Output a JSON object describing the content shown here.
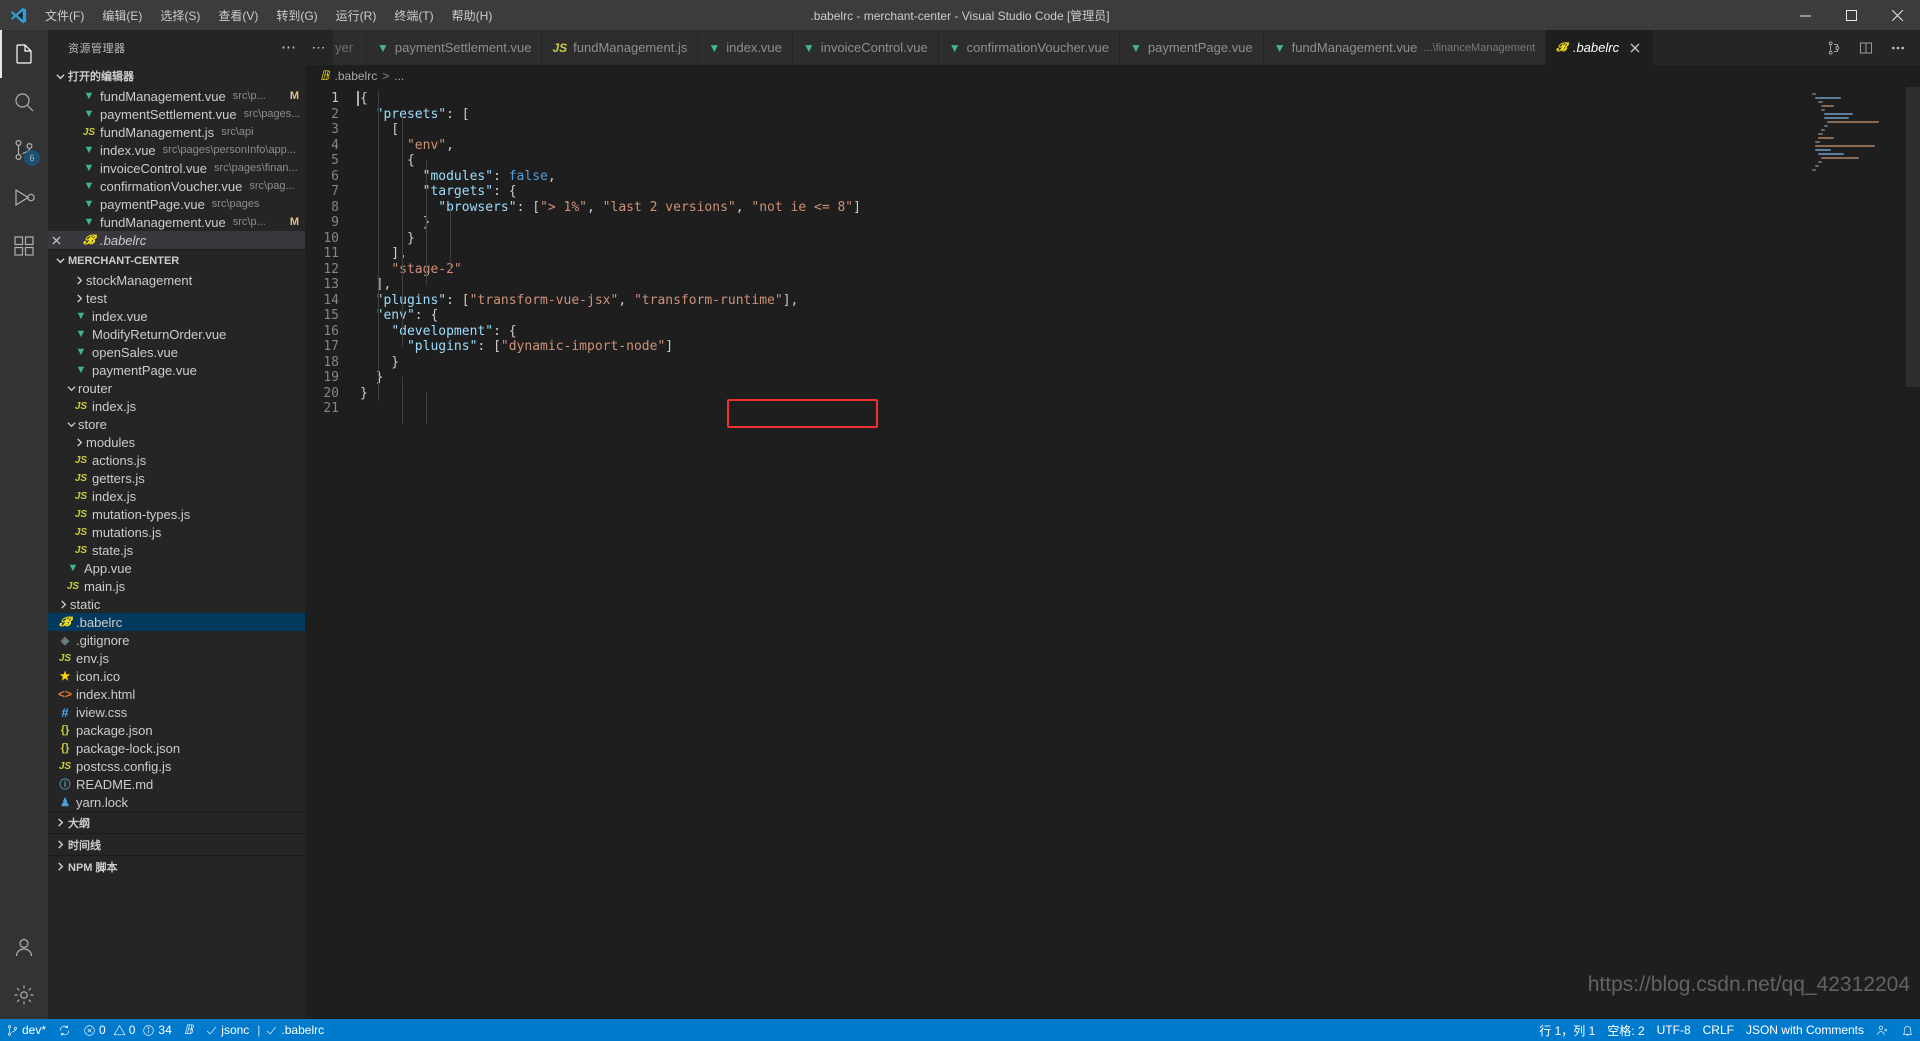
{
  "window": {
    "title": ".babelrc - merchant-center - Visual Studio Code [管理员]",
    "logo_name": "vscode-logo"
  },
  "menubar": [
    {
      "label": "文件(F)"
    },
    {
      "label": "编辑(E)"
    },
    {
      "label": "选择(S)"
    },
    {
      "label": "查看(V)"
    },
    {
      "label": "转到(G)"
    },
    {
      "label": "运行(R)"
    },
    {
      "label": "终端(T)"
    },
    {
      "label": "帮助(H)"
    }
  ],
  "window_controls": {
    "minimize": "minimize-button",
    "maximize": "maximize-button",
    "close": "close-button"
  },
  "activitybar": [
    {
      "name": "explorer",
      "icon": "files-icon",
      "active": true,
      "badge": ""
    },
    {
      "name": "search",
      "icon": "search-icon",
      "active": false,
      "badge": ""
    },
    {
      "name": "source-control",
      "icon": "source-control-icon",
      "active": false,
      "badge": "6"
    },
    {
      "name": "run-and-debug",
      "icon": "run-debug-icon",
      "active": false,
      "badge": ""
    },
    {
      "name": "extensions",
      "icon": "extensions-icon",
      "active": false,
      "badge": ""
    },
    {
      "name": "accounts",
      "icon": "account-icon",
      "active": false,
      "badge": ""
    },
    {
      "name": "manage",
      "icon": "gear-icon",
      "active": false,
      "badge": ""
    }
  ],
  "sidebar": {
    "title": "资源管理器",
    "open_editors": {
      "label": "打开的编辑器",
      "expanded": true,
      "items": [
        {
          "icon": "vue",
          "name": "fundManagement.vue",
          "desc": "src\\p...",
          "badge": "M",
          "active": false
        },
        {
          "icon": "vue",
          "name": "paymentSettlement.vue",
          "desc": "src\\pages...",
          "badge": "",
          "active": false
        },
        {
          "icon": "js",
          "name": "fundManagement.js",
          "desc": "src\\api",
          "badge": "",
          "active": false
        },
        {
          "icon": "vue",
          "name": "index.vue",
          "desc": "src\\pages\\personInfo\\app...",
          "badge": "",
          "active": false
        },
        {
          "icon": "vue",
          "name": "invoiceControl.vue",
          "desc": "src\\pages\\finan...",
          "badge": "",
          "active": false
        },
        {
          "icon": "vue",
          "name": "confirmationVoucher.vue",
          "desc": "src\\pag...",
          "badge": "",
          "active": false
        },
        {
          "icon": "vue",
          "name": "paymentPage.vue",
          "desc": "src\\pages",
          "badge": "",
          "active": false
        },
        {
          "icon": "vue",
          "name": "fundManagement.vue",
          "desc": "src\\p...",
          "badge": "M",
          "active": false
        },
        {
          "icon": "babel",
          "name": ".babelrc",
          "desc": "",
          "badge": "",
          "active": true,
          "italic": true,
          "closable": true
        }
      ]
    },
    "project": {
      "label": "MERCHANT-CENTER",
      "expanded": true,
      "items": [
        {
          "type": "folder",
          "name": "stockManagement",
          "depth": 2,
          "expanded": false
        },
        {
          "type": "folder",
          "name": "test",
          "depth": 2,
          "expanded": false
        },
        {
          "type": "vue",
          "name": "index.vue",
          "depth": 2
        },
        {
          "type": "vue",
          "name": "ModifyReturnOrder.vue",
          "depth": 2
        },
        {
          "type": "vue",
          "name": "openSales.vue",
          "depth": 2
        },
        {
          "type": "vue",
          "name": "paymentPage.vue",
          "depth": 2
        },
        {
          "type": "folder",
          "name": "router",
          "depth": 1,
          "expanded": true
        },
        {
          "type": "js",
          "name": "index.js",
          "depth": 2
        },
        {
          "type": "folder",
          "name": "store",
          "depth": 1,
          "expanded": true
        },
        {
          "type": "folder",
          "name": "modules",
          "depth": 2,
          "expanded": false
        },
        {
          "type": "js",
          "name": "actions.js",
          "depth": 2
        },
        {
          "type": "js",
          "name": "getters.js",
          "depth": 2
        },
        {
          "type": "js",
          "name": "index.js",
          "depth": 2
        },
        {
          "type": "js",
          "name": "mutation-types.js",
          "depth": 2
        },
        {
          "type": "js",
          "name": "mutations.js",
          "depth": 2
        },
        {
          "type": "js",
          "name": "state.js",
          "depth": 2
        },
        {
          "type": "vue",
          "name": "App.vue",
          "depth": 1
        },
        {
          "type": "js",
          "name": "main.js",
          "depth": 1
        },
        {
          "type": "folder",
          "name": "static",
          "depth": 0,
          "expanded": false
        },
        {
          "type": "babel",
          "name": ".babelrc",
          "depth": 0,
          "selected": true
        },
        {
          "type": "git",
          "name": ".gitignore",
          "depth": 0
        },
        {
          "type": "js",
          "name": "env.js",
          "depth": 0
        },
        {
          "type": "star",
          "name": "icon.ico",
          "depth": 0
        },
        {
          "type": "html",
          "name": "index.html",
          "depth": 0
        },
        {
          "type": "css",
          "name": "iview.css",
          "depth": 0
        },
        {
          "type": "json",
          "name": "package.json",
          "depth": 0
        },
        {
          "type": "json",
          "name": "package-lock.json",
          "depth": 0
        },
        {
          "type": "js",
          "name": "postcss.config.js",
          "depth": 0
        },
        {
          "type": "md",
          "name": "README.md",
          "depth": 0
        },
        {
          "type": "lock",
          "name": "yarn.lock",
          "depth": 0
        }
      ]
    },
    "bottom_sections": [
      {
        "label": "大纲",
        "expanded": false
      },
      {
        "label": "时间线",
        "expanded": false
      },
      {
        "label": "NPM 脚本",
        "expanded": false
      }
    ]
  },
  "tabs": {
    "scrolled_fragment": "yer",
    "more_icon": "more-tabs-icon",
    "items": [
      {
        "icon": "vue",
        "label": "paymentSettlement.vue",
        "desc": "",
        "active": false
      },
      {
        "icon": "js",
        "label": "fundManagement.js",
        "desc": "",
        "active": false
      },
      {
        "icon": "vue",
        "label": "index.vue",
        "desc": "",
        "active": false
      },
      {
        "icon": "vue",
        "label": "invoiceControl.vue",
        "desc": "",
        "active": false
      },
      {
        "icon": "vue",
        "label": "confirmationVoucher.vue",
        "desc": "",
        "active": false
      },
      {
        "icon": "vue",
        "label": "paymentPage.vue",
        "desc": "",
        "active": false
      },
      {
        "icon": "vue",
        "label": "fundManagement.vue",
        "desc": "...\\financeManagement",
        "active": false
      },
      {
        "icon": "babel",
        "label": ".babelrc",
        "desc": "",
        "active": true,
        "italic": true,
        "closable": true
      }
    ],
    "actions": [
      {
        "name": "open-changes-icon"
      },
      {
        "name": "split-editor-icon"
      },
      {
        "name": "more-actions-icon"
      }
    ]
  },
  "breadcrumb": {
    "icon": "babel",
    "file": ".babelrc",
    "separator": ">",
    "symbol": "..."
  },
  "code": {
    "language": "JSON with Comments",
    "lines": [
      {
        "n": 1,
        "tokens": [
          {
            "t": "{",
            "c": "pun"
          }
        ]
      },
      {
        "n": 2,
        "tokens": [
          {
            "t": "  ",
            "c": "pun"
          },
          {
            "t": "\"presets\"",
            "c": "key"
          },
          {
            "t": ": [",
            "c": "pun"
          }
        ]
      },
      {
        "n": 3,
        "tokens": [
          {
            "t": "    [",
            "c": "pun"
          }
        ]
      },
      {
        "n": 4,
        "tokens": [
          {
            "t": "      ",
            "c": "pun"
          },
          {
            "t": "\"env\"",
            "c": "str"
          },
          {
            "t": ",",
            "c": "pun"
          }
        ]
      },
      {
        "n": 5,
        "tokens": [
          {
            "t": "      {",
            "c": "pun"
          }
        ]
      },
      {
        "n": 6,
        "tokens": [
          {
            "t": "        ",
            "c": "pun"
          },
          {
            "t": "\"modules\"",
            "c": "key"
          },
          {
            "t": ": ",
            "c": "pun"
          },
          {
            "t": "false",
            "c": "kw"
          },
          {
            "t": ",",
            "c": "pun"
          }
        ]
      },
      {
        "n": 7,
        "tokens": [
          {
            "t": "        ",
            "c": "pun"
          },
          {
            "t": "\"targets\"",
            "c": "key"
          },
          {
            "t": ": {",
            "c": "pun"
          }
        ]
      },
      {
        "n": 8,
        "tokens": [
          {
            "t": "          ",
            "c": "pun"
          },
          {
            "t": "\"browsers\"",
            "c": "key"
          },
          {
            "t": ": [",
            "c": "pun"
          },
          {
            "t": "\"> 1%\"",
            "c": "str"
          },
          {
            "t": ", ",
            "c": "pun"
          },
          {
            "t": "\"last 2 versions\"",
            "c": "str"
          },
          {
            "t": ", ",
            "c": "pun"
          },
          {
            "t": "\"not ie <= 8\"",
            "c": "str"
          },
          {
            "t": "]",
            "c": "pun"
          }
        ]
      },
      {
        "n": 9,
        "tokens": [
          {
            "t": "        }",
            "c": "pun"
          }
        ]
      },
      {
        "n": 10,
        "tokens": [
          {
            "t": "      }",
            "c": "pun"
          }
        ]
      },
      {
        "n": 11,
        "tokens": [
          {
            "t": "    ],",
            "c": "pun"
          }
        ]
      },
      {
        "n": 12,
        "tokens": [
          {
            "t": "    ",
            "c": "pun"
          },
          {
            "t": "\"stage-2\"",
            "c": "str"
          }
        ]
      },
      {
        "n": 13,
        "tokens": [
          {
            "t": "  ],",
            "c": "pun"
          }
        ]
      },
      {
        "n": 14,
        "tokens": [
          {
            "t": "  ",
            "c": "pun"
          },
          {
            "t": "\"plugins\"",
            "c": "key"
          },
          {
            "t": ": [",
            "c": "pun"
          },
          {
            "t": "\"transform-vue-jsx\"",
            "c": "str"
          },
          {
            "t": ", ",
            "c": "pun"
          },
          {
            "t": "\"transform-runtime\"",
            "c": "str"
          },
          {
            "t": "],",
            "c": "pun"
          }
        ]
      },
      {
        "n": 15,
        "tokens": [
          {
            "t": "  ",
            "c": "pun"
          },
          {
            "t": "\"env\"",
            "c": "key"
          },
          {
            "t": ": {",
            "c": "pun"
          }
        ]
      },
      {
        "n": 16,
        "tokens": [
          {
            "t": "    ",
            "c": "pun"
          },
          {
            "t": "\"development\"",
            "c": "key"
          },
          {
            "t": ": {",
            "c": "pun"
          }
        ]
      },
      {
        "n": 17,
        "tokens": [
          {
            "t": "      ",
            "c": "pun"
          },
          {
            "t": "\"plugins\"",
            "c": "key"
          },
          {
            "t": ": [",
            "c": "pun"
          },
          {
            "t": "\"dynamic-import-node\"",
            "c": "str"
          },
          {
            "t": "]",
            "c": "pun"
          }
        ]
      },
      {
        "n": 18,
        "tokens": [
          {
            "t": "    }",
            "c": "pun"
          }
        ]
      },
      {
        "n": 19,
        "tokens": [
          {
            "t": "  }",
            "c": "pun"
          }
        ]
      },
      {
        "n": 20,
        "tokens": [
          {
            "t": "}",
            "c": "pun"
          }
        ]
      },
      {
        "n": 21,
        "tokens": []
      }
    ],
    "annotation": {
      "name": "red-highlight-box",
      "color": "#f03030"
    }
  },
  "statusbar": {
    "left": [
      {
        "name": "branch",
        "icon": "source-control-icon",
        "label": "dev*"
      },
      {
        "name": "sync",
        "icon": "sync-icon",
        "label": ""
      },
      {
        "name": "problems",
        "icon": "errors-icon",
        "label": "0",
        "icon2": "warnings-icon",
        "label2": "0",
        "icon3": "info-icon",
        "label3": "34"
      },
      {
        "name": "babel-status",
        "icon": "babel-icon",
        "label": ""
      },
      {
        "name": "eslint",
        "icon": "check-icon",
        "label": "jsonc"
      },
      {
        "name": "file-check",
        "icon": "check-icon",
        "label": ".babelrc"
      }
    ],
    "right": [
      {
        "name": "cursor-position",
        "label": "行 1，列 1"
      },
      {
        "name": "indentation",
        "label": "空格: 2"
      },
      {
        "name": "encoding",
        "label": "UTF-8"
      },
      {
        "name": "eol",
        "label": "CRLF"
      },
      {
        "name": "language-mode",
        "label": "JSON with Comments"
      },
      {
        "name": "live-share",
        "icon": "live-share-icon",
        "label": ""
      },
      {
        "name": "notifications",
        "icon": "bell-icon",
        "label": ""
      }
    ]
  },
  "watermark": {
    "text": "https://blog.csdn.net/qq_42312204"
  },
  "colors": {
    "accent": "#007acc",
    "titlebar_bg": "#3c3c3c",
    "sidebar_bg": "#252526",
    "editor_bg": "#1e1e1e",
    "selection_blue": "#04395e",
    "vue_green": "#41b883",
    "annotation_red": "#f03030"
  }
}
